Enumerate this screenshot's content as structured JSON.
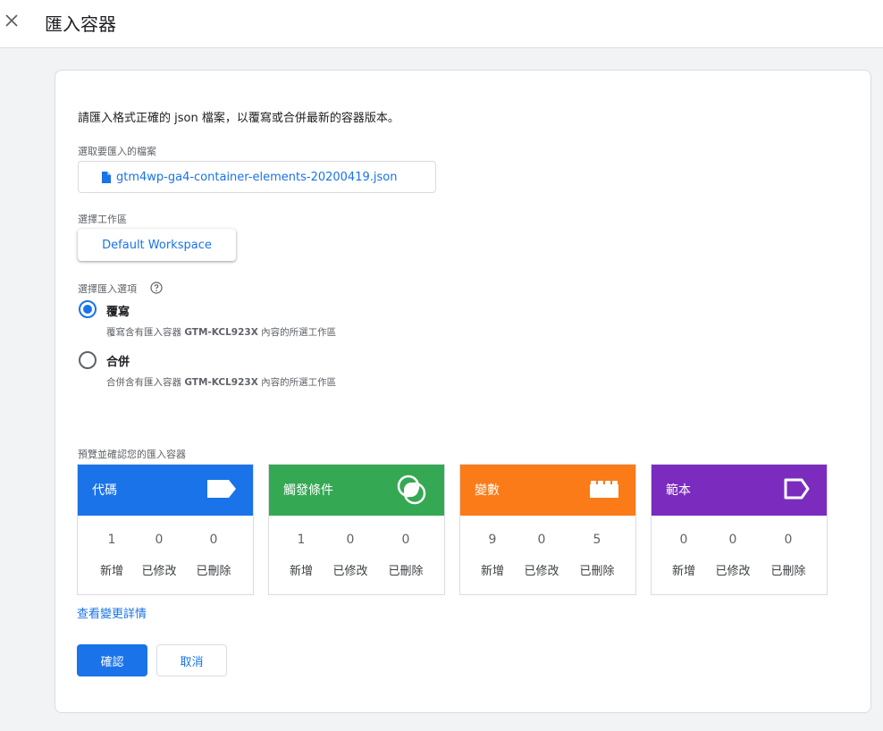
{
  "header": {
    "title": "匯入容器",
    "close_icon": "close-icon"
  },
  "intro": "請匯入格式正確的 json 檔案，以覆寫或合併最新的容器版本。",
  "file": {
    "label": "選取要匯入的檔案",
    "filename": "gtm4wp-ga4-container-elements-20200419.json",
    "icon": "file-icon"
  },
  "workspace": {
    "label": "選擇工作區",
    "button": "Default Workspace"
  },
  "import_option": {
    "label": "選擇匯入選項",
    "help_icon": "help-icon",
    "selected": "overwrite",
    "options": [
      {
        "label": "覆寫",
        "desc_prefix": "覆寫含有匯入容器 ",
        "container": "GTM-KCL923X",
        "desc_suffix": " 內容的所選工作區"
      },
      {
        "label": "合併",
        "desc_prefix": "合併含有匯入容器 ",
        "container": "GTM-KCL923X",
        "desc_suffix": " 內容的所選工作區"
      }
    ]
  },
  "preview": {
    "label": "預覽並確認您的匯入容器",
    "stat_labels": [
      "新增",
      "已修改",
      "已刪除"
    ],
    "tiles": [
      {
        "name": "代碼",
        "color": "#1a73e8",
        "icon": "tag-icon",
        "values": [
          "1",
          "0",
          "0"
        ]
      },
      {
        "name": "觸發條件",
        "color": "#34a853",
        "icon": "trigger-icon",
        "values": [
          "1",
          "0",
          "0"
        ]
      },
      {
        "name": "變數",
        "color": "#fa7b17",
        "icon": "variable-icon",
        "values": [
          "9",
          "0",
          "5"
        ]
      },
      {
        "name": "範本",
        "color": "#7b2cbf",
        "icon": "template-icon",
        "values": [
          "0",
          "0",
          "0"
        ]
      }
    ]
  },
  "details_link": "查看變更詳情",
  "actions": {
    "confirm": "確認",
    "cancel": "取消"
  }
}
